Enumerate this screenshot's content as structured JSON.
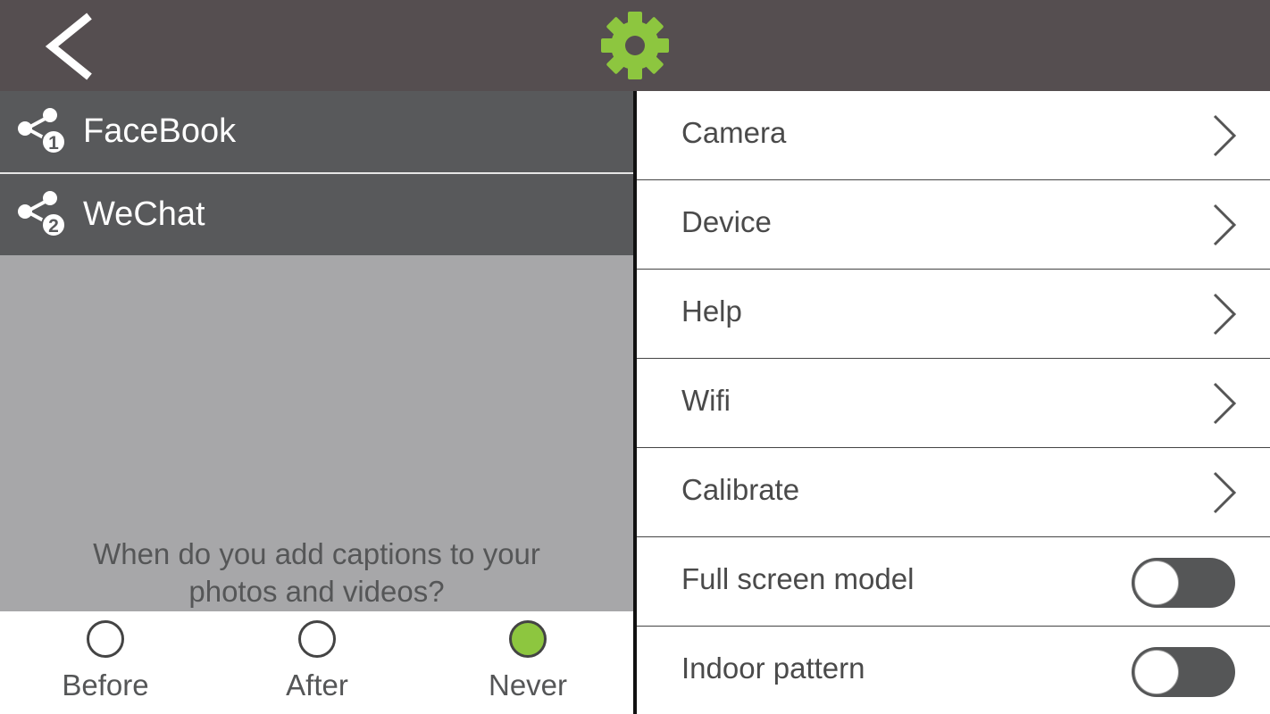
{
  "header": {
    "back_icon": "chevron-left-icon",
    "settings_icon": "gear-icon",
    "accent_color": "#8dc63f",
    "bar_color": "#554e50"
  },
  "share": {
    "items": [
      {
        "label": "FaceBook",
        "badge": "1",
        "icon": "share-icon"
      },
      {
        "label": "WeChat",
        "badge": "2",
        "icon": "share-icon"
      }
    ]
  },
  "caption": {
    "question_line1": "When do you add captions to your",
    "question_line2": "photos and videos?",
    "options": [
      {
        "label": "Before",
        "checked": false
      },
      {
        "label": "After",
        "checked": false
      },
      {
        "label": "Never",
        "checked": true
      }
    ]
  },
  "settings": {
    "items": [
      {
        "label": "Camera",
        "type": "link"
      },
      {
        "label": "Device",
        "type": "link"
      },
      {
        "label": "Help",
        "type": "link"
      },
      {
        "label": "Wifi",
        "type": "link"
      },
      {
        "label": "Calibrate",
        "type": "link"
      },
      {
        "label": "Full screen model",
        "type": "toggle",
        "on": false
      },
      {
        "label": "Indoor pattern",
        "type": "toggle",
        "on": false
      }
    ]
  }
}
